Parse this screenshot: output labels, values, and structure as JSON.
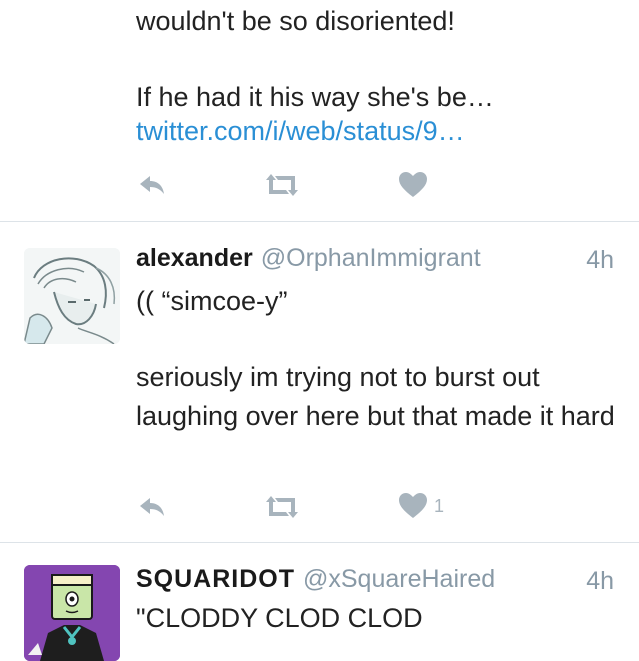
{
  "tweet_prev": {
    "line1": "wouldn't be so disoriented!",
    "line2": "If he had it his way she's be…",
    "link": "twitter.com/i/web/status/9…"
  },
  "tweet1": {
    "display_name": "alexander",
    "handle": "@OrphanImmigrant",
    "time": "4h",
    "body_line1": "(( “simcoe-y”",
    "body_rest": "seriously im trying not to burst out laughing over here but that made it hard",
    "like_count": "1"
  },
  "tweet2": {
    "display_name": "SQUARIDOT",
    "handle": "@xSquareHaired",
    "time": "4h",
    "body_line1": "\"CLODDY CLOD CLOD"
  },
  "icons": {
    "reply": "reply-icon",
    "retweet": "retweet-icon",
    "like": "heart-icon"
  },
  "colors": {
    "link": "#2a8fd5",
    "muted": "#8899a6",
    "action_icon": "#a8b4bd"
  }
}
